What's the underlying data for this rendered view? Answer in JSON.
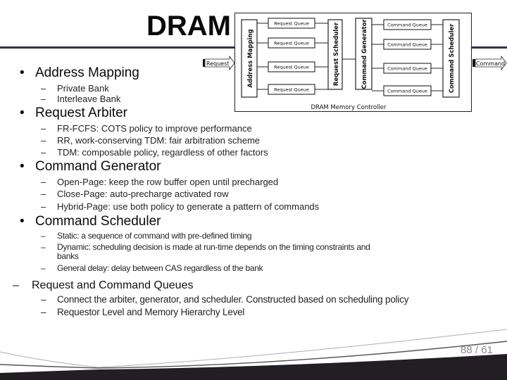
{
  "slide": {
    "title": "DRAM",
    "page_current": "88",
    "page_separator": "/",
    "page_total": "61"
  },
  "diagram": {
    "caption": "DRAM Memory Controller",
    "input_label": "Request",
    "output_label": "Command",
    "address_mapping": "Address Mapping",
    "request_scheduler": "Request Scheduler",
    "command_generator": "Command Generator",
    "command_scheduler": "Command Scheduler",
    "request_queues": [
      "Request Queue",
      "Request Queue",
      "Request Queue",
      "Request Queue"
    ],
    "command_queues": [
      "Command Queue",
      "Command Queue",
      "Command Queue",
      "Command Queue"
    ]
  },
  "bullets": [
    {
      "label": "Address Mapping",
      "sub": [
        "Private Bank",
        "Interleave Bank"
      ]
    },
    {
      "label": "Request Arbiter",
      "sub": [
        "FR-FCFS: COTS policy to improve performance",
        "RR, work-conserving TDM: fair arbitration scheme",
        "TDM: composable policy, regardless of other factors"
      ]
    },
    {
      "label": "Command Generator",
      "sub": [
        "Open-Page: keep the row buffer open until precharged",
        "Close-Page: auto-precharge activated row",
        "Hybrid-Page: use both policy to generate a pattern of commands"
      ]
    },
    {
      "label": "Command Scheduler",
      "sub": [
        "Static: a sequence of command with pre-defined timing",
        "Dynamic: scheduling decision is made at run-time depends on the timing constraints and",
        "banks",
        "General delay: delay between CAS regardless of the bank"
      ]
    },
    {
      "label": "Request and Command Queues",
      "sub": [
        "Connect the arbiter, generator, and scheduler. Constructed based on scheduling policy",
        "Requestor Level and Memory Hierarchy Level"
      ]
    }
  ],
  "bullet_glyph": "•",
  "dash_glyph": "–"
}
